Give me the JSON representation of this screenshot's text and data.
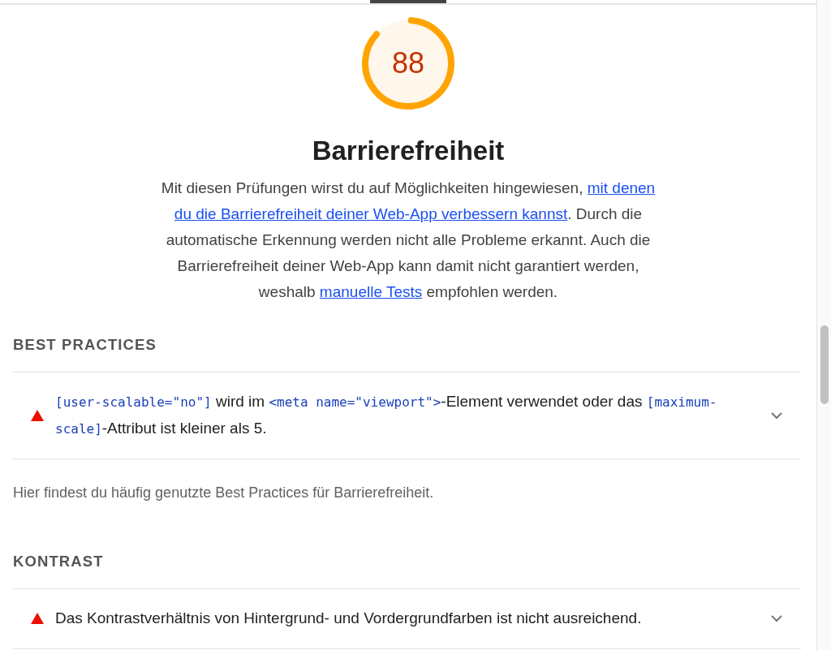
{
  "tabs_indicator": {
    "selected": true
  },
  "gauge": {
    "score": "88",
    "level": 0.88,
    "kind": "average"
  },
  "category": {
    "title": "Barrierefreiheit",
    "description": [
      {
        "kind": "text",
        "text": "Mit diesen Prüfungen wirst du auf Möglichkeiten hingewiesen, "
      },
      {
        "kind": "link",
        "lines": [
          "mit denen",
          "du die Barrierefreiheit deiner Web-App verbessern kannst"
        ]
      },
      {
        "kind": "text",
        "text": ". Durch die automatische Erkennung werden nicht alle Probleme erkannt. Auch die Barrierefreiheit deiner Web-App kann damit nicht garantiert werden, weshalb "
      },
      {
        "kind": "link",
        "lines": [
          "manuelle Tests"
        ]
      },
      {
        "kind": "text",
        "text": " empfohlen werden."
      }
    ]
  },
  "groups": [
    {
      "title": "BEST PRACTICES",
      "audits": [
        {
          "kind": "fail",
          "expanded": false,
          "segments": [
            {
              "kind": "code",
              "text": "[user-scalable=\"no\"]"
            },
            {
              "kind": "text",
              "text": " wird im "
            },
            {
              "kind": "code",
              "text": "<meta name=\"viewport\">"
            },
            {
              "kind": "text",
              "text": "-Element verwendet oder das "
            },
            {
              "kind": "code",
              "text": "[maximum-scale]"
            },
            {
              "kind": "text",
              "text": "-Attribut ist kleiner als 5."
            }
          ]
        }
      ],
      "description": "Hier findest du häufig genutzte Best Practices für Barrierefreiheit."
    },
    {
      "title": "KONTRAST",
      "audits": [
        {
          "kind": "fail",
          "expanded": false,
          "segments": [
            {
              "kind": "text",
              "text": "Das Kontrastverhältnis von Hintergrund- und Vordergrundfarben ist nicht ausreichend."
            }
          ]
        }
      ]
    }
  ]
}
